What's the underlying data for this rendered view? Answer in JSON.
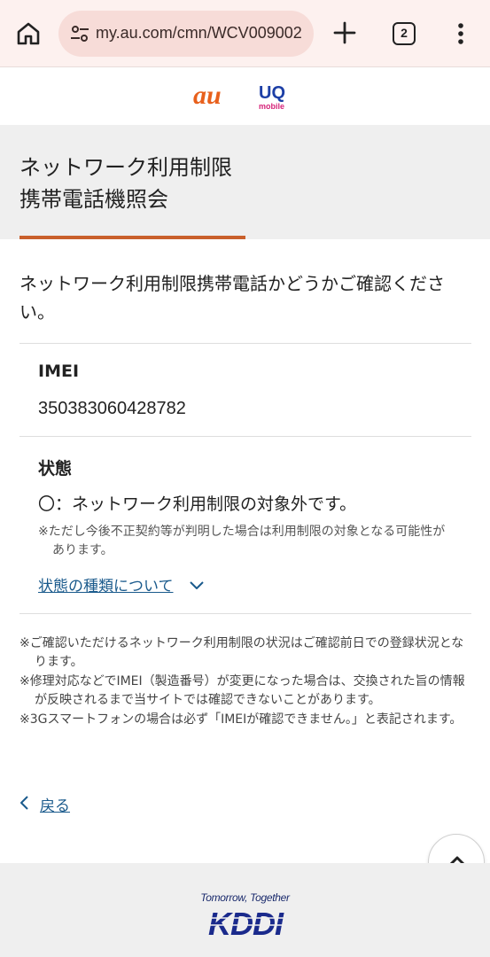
{
  "browser": {
    "url": "my.au.com/cmn/WCV009002",
    "tab_count": "2"
  },
  "brand": {
    "au_logo": "au",
    "uq_logo_main": "UQ",
    "uq_logo_sub": "mobile",
    "au_color": "#e8601c",
    "uq_color": "#1d3fa6",
    "uq_sub_color": "#d6247a"
  },
  "page": {
    "title_line1": "ネットワーク利用制限",
    "title_line2": "携帯電話機照会",
    "accent_color": "#c9602c",
    "intro": "ネットワーク利用制限携帯電話かどうかご確認ください。"
  },
  "imei": {
    "label": "IMEI",
    "value": "350383060428782"
  },
  "status": {
    "label": "状態",
    "value": "〇：ネットワーク利用制限の対象外です。",
    "note": "※ただし今後不正契約等が判明した場合は利用制限の対象となる可能性があります。",
    "link": "状態の種類について",
    "link_icon": "chevron-down-icon"
  },
  "notes": [
    "※ご確認いただけるネットワーク利用制限の状況はご確認前日での登録状況となります。",
    "※修理対応などでIMEI（製造番号）が変更になった場合は、交換された旨の情報が反映されるまで当サイトでは確認できないことがあります。",
    "※3Gスマートフォンの場合は必ず「IMEIが確認できません。」と表記されます。"
  ],
  "back": {
    "label": "戻る",
    "icon": "chevron-left-icon"
  },
  "scroll_top": {
    "icon": "chevron-up-icon"
  },
  "footer": {
    "tagline": "Tomorrow, Together",
    "logo": "KDDI",
    "logo_color": "#1a2a8c"
  }
}
